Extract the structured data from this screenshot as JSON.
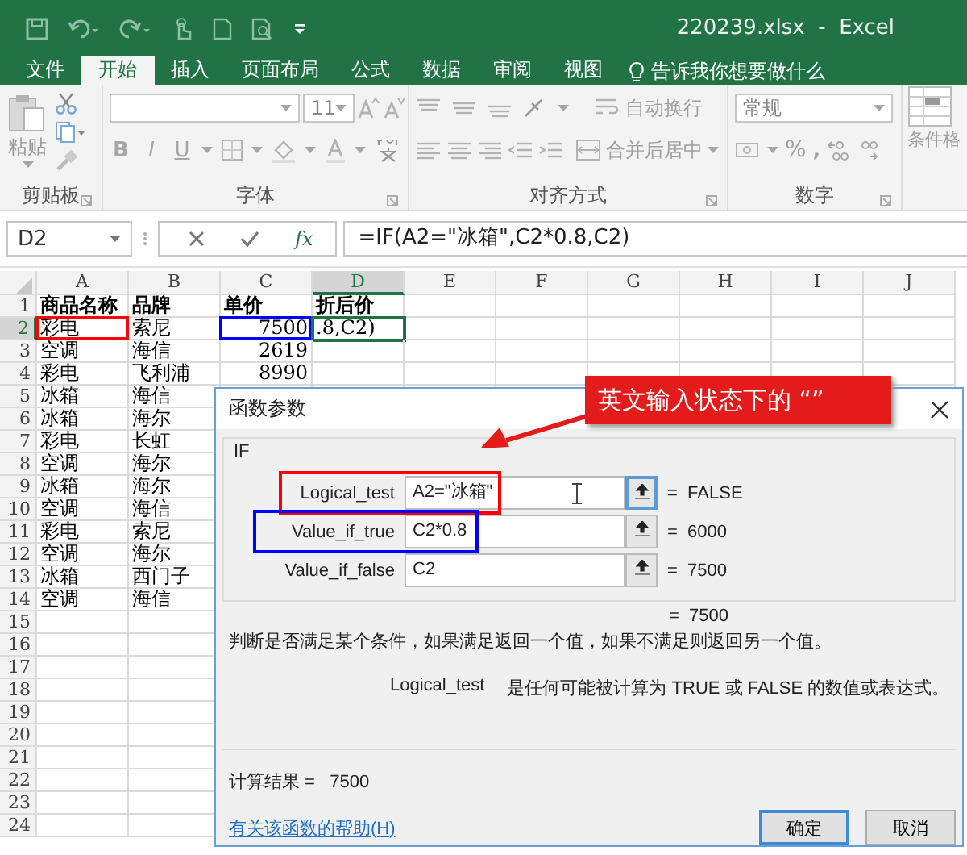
{
  "window": {
    "title": "220239.xlsx  -  Excel"
  },
  "ribbon_tabs": [
    {
      "label": "文件",
      "selected": false
    },
    {
      "label": "开始",
      "selected": true
    },
    {
      "label": "插入",
      "selected": false
    },
    {
      "label": "页面布局",
      "selected": false
    },
    {
      "label": "公式",
      "selected": false
    },
    {
      "label": "数据",
      "selected": false
    },
    {
      "label": "审阅",
      "selected": false
    },
    {
      "label": "视图",
      "selected": false
    }
  ],
  "tell_me": "告诉我你想要做什么",
  "ribbon": {
    "paste": "粘贴",
    "font_size": "11",
    "font_styles": [
      "B",
      "I",
      "U"
    ],
    "wrap_text": "自动换行",
    "merge_center": "合并后居中",
    "number_format": "常规",
    "percent": "%",
    "comma": ",",
    "conditional_format": "条件格",
    "groups": [
      "剪贴板",
      "字体",
      "对齐方式",
      "数字"
    ]
  },
  "formula_bar": {
    "name_box": "D2",
    "fx": "fx",
    "formula": "=IF(A2=\"冰箱\",C2*0.8,C2)"
  },
  "sheet": {
    "columns": [
      {
        "label": "A",
        "selected": false
      },
      {
        "label": "B",
        "selected": false
      },
      {
        "label": "C",
        "selected": false
      },
      {
        "label": "D",
        "selected": true
      },
      {
        "label": "E",
        "selected": false
      },
      {
        "label": "F",
        "selected": false
      },
      {
        "label": "G",
        "selected": false
      },
      {
        "label": "H",
        "selected": false
      },
      {
        "label": "I",
        "selected": false
      },
      {
        "label": "J",
        "selected": false
      }
    ],
    "rows": [
      {
        "number": "1",
        "selected": false,
        "cells": [
          {
            "text": "商品名称"
          },
          {
            "text": "品牌"
          },
          {
            "text": "单价"
          },
          {
            "text": "折后价"
          }
        ]
      },
      {
        "number": "2",
        "selected": true,
        "cells": [
          {
            "text": "彩电",
            "color": "#ff0000"
          },
          {
            "text": "索尼"
          },
          {
            "text": "7500",
            "color": "#0000ff"
          },
          {
            "text": ".8,C2)"
          }
        ]
      },
      {
        "number": "3",
        "selected": false,
        "cells": [
          {
            "text": "空调"
          },
          {
            "text": "海信"
          },
          {
            "text": "2619"
          }
        ]
      },
      {
        "number": "4",
        "selected": false,
        "cells": [
          {
            "text": "彩电"
          },
          {
            "text": "飞利浦"
          },
          {
            "text": "8990"
          }
        ]
      },
      {
        "number": "5",
        "selected": false,
        "cells": [
          {
            "text": "冰箱"
          },
          {
            "text": "海信"
          }
        ]
      },
      {
        "number": "6",
        "selected": false,
        "cells": [
          {
            "text": "冰箱"
          },
          {
            "text": "海尔"
          }
        ]
      },
      {
        "number": "7",
        "selected": false,
        "cells": [
          {
            "text": "彩电"
          },
          {
            "text": "长虹"
          }
        ]
      },
      {
        "number": "8",
        "selected": false,
        "cells": [
          {
            "text": "空调"
          },
          {
            "text": "海尔"
          }
        ]
      },
      {
        "number": "9",
        "selected": false,
        "cells": [
          {
            "text": "冰箱"
          },
          {
            "text": "海尔"
          }
        ]
      },
      {
        "number": "10",
        "selected": false,
        "cells": [
          {
            "text": "空调"
          },
          {
            "text": "海信"
          }
        ]
      },
      {
        "number": "11",
        "selected": false,
        "cells": [
          {
            "text": "彩电"
          },
          {
            "text": "索尼"
          }
        ]
      },
      {
        "number": "12",
        "selected": false,
        "cells": [
          {
            "text": "空调"
          },
          {
            "text": "海尔"
          }
        ]
      },
      {
        "number": "13",
        "selected": false,
        "cells": [
          {
            "text": "冰箱"
          },
          {
            "text": "西门子"
          }
        ]
      },
      {
        "number": "14",
        "selected": false,
        "cells": [
          {
            "text": "空调"
          },
          {
            "text": "海信"
          }
        ]
      },
      {
        "number": "15",
        "selected": false,
        "cells": []
      },
      {
        "number": "16",
        "selected": false,
        "cells": []
      },
      {
        "number": "17",
        "selected": false,
        "cells": []
      },
      {
        "number": "18",
        "selected": false,
        "cells": []
      },
      {
        "number": "19",
        "selected": false,
        "cells": []
      },
      {
        "number": "20",
        "selected": false,
        "cells": []
      },
      {
        "number": "21",
        "selected": false,
        "cells": []
      },
      {
        "number": "22",
        "selected": false,
        "cells": []
      },
      {
        "number": "23",
        "selected": false,
        "cells": []
      },
      {
        "number": "24",
        "selected": false,
        "cells": []
      }
    ]
  },
  "dialog": {
    "title": "函数参数",
    "function": "IF",
    "arguments": [
      {
        "label": "Logical_test",
        "value": "A2=\"冰箱\"",
        "result": "=  FALSE",
        "focused": true,
        "color": "#ff0000"
      },
      {
        "label": "Value_if_true",
        "value": "C2*0.8",
        "result": "=  6000",
        "focused": false,
        "color": "#0000ff"
      },
      {
        "label": "Value_if_false",
        "value": "C2",
        "result": "=  7500",
        "focused": false
      }
    ],
    "result": "=  7500",
    "description": "判断是否满足某个条件，如果满足返回一个值，如果不满足则返回另一个值。",
    "argument_name": "Logical_test",
    "argument_help": "是任何可能被计算为 TRUE 或 FALSE 的数值或表达式。",
    "formula_result": "计算结果 =   7500",
    "help_link": "有关该函数的帮助(H)",
    "buttons": [
      {
        "label": "确定",
        "default": true
      },
      {
        "label": "取消",
        "default": false
      }
    ]
  },
  "callout": {
    "text": "英文输入状态下的 “”"
  }
}
